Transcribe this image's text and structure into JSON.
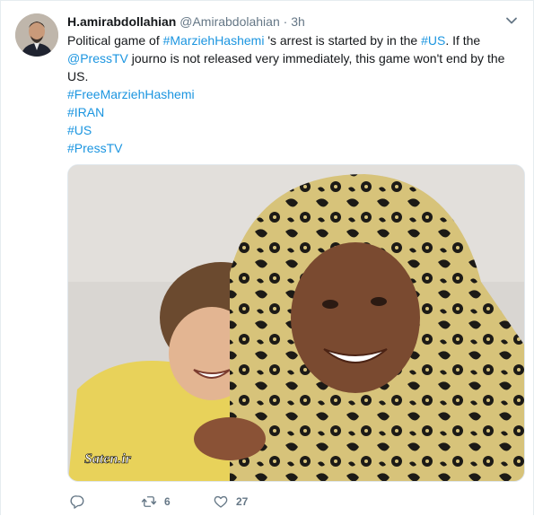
{
  "tweet": {
    "author_name": "H.amirabdollahian",
    "author_handle": "@Amirabdolahian",
    "separator": "·",
    "time": "3h",
    "text": {
      "line1_a": "Political game of ",
      "line1_tag": "#MarziehHashemi",
      "line1_b": " 's arrest is started by in the ",
      "line1_tag2": "#US",
      "line1_c": ". If the",
      "line2_mention": "@PressTV",
      "line2_b": " journo is not released very immediately, this game won't end by the",
      "line3": "US."
    },
    "hashtags": [
      "#FreeMarziehHashemi",
      "#IRAN",
      "#US",
      "#PressTV"
    ],
    "media": {
      "watermark": "Saten.ir"
    },
    "actions": {
      "reply_count": "",
      "retweet_count": "6",
      "like_count": "27"
    }
  },
  "colors": {
    "link": "#1b95e0",
    "muted": "#657786",
    "text": "#14171a"
  },
  "icons": {
    "reply": "reply-icon",
    "retweet": "retweet-icon",
    "like": "heart-icon",
    "menu": "chevron-down-icon"
  }
}
